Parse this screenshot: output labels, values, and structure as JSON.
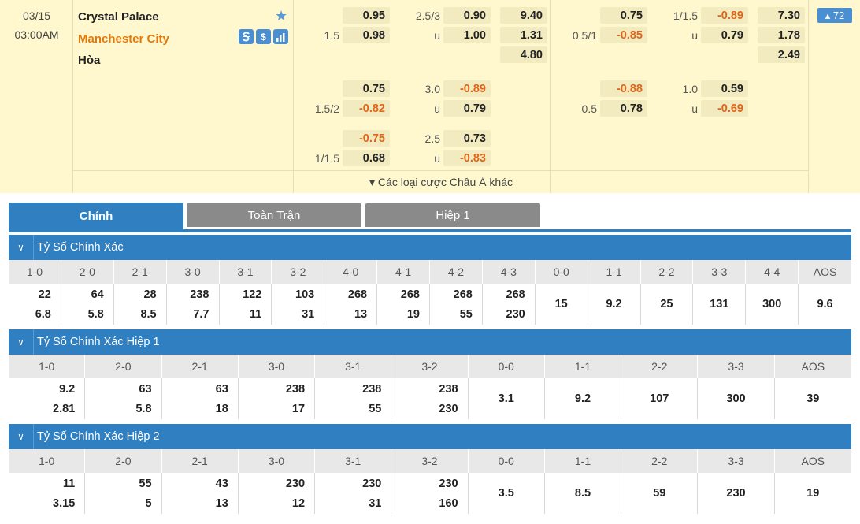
{
  "match": {
    "date": "03/15",
    "time": "03:00AM",
    "home": "Crystal Palace",
    "away": "Manchester City",
    "draw": "Hòa",
    "tools": [
      "S",
      "$",
      "chart"
    ],
    "full_time": {
      "rows": [
        {
          "hdp": "",
          "h": "0.95",
          "ou": "2.5/3",
          "o": "0.90",
          "x1": "9.40"
        },
        {
          "hdp": "1.5",
          "h": "0.98",
          "ou": "u",
          "o": "1.00",
          "x1": "1.31"
        },
        {
          "hdp": "",
          "h": "",
          "ou": "",
          "o": "",
          "x1": "4.80"
        },
        {
          "hdp": "",
          "h": "0.75",
          "ou": "3.0",
          "o": "-0.89",
          "x1": ""
        },
        {
          "hdp": "1.5/2",
          "h": "-0.82",
          "ou": "u",
          "o": "0.79",
          "x1": ""
        },
        {
          "hdp": "",
          "h": "-0.75",
          "ou": "2.5",
          "o": "0.73",
          "x1": ""
        },
        {
          "hdp": "1/1.5",
          "h": "0.68",
          "ou": "u",
          "o": "-0.83",
          "x1": ""
        }
      ]
    },
    "half_time": {
      "rows": [
        {
          "hdp": "",
          "h": "0.75",
          "ou": "1/1.5",
          "o": "-0.89",
          "x1": "7.30"
        },
        {
          "hdp": "0.5/1",
          "h": "-0.85",
          "ou": "u",
          "o": "0.79",
          "x1": "1.78"
        },
        {
          "hdp": "",
          "h": "",
          "ou": "",
          "o": "",
          "x1": "2.49"
        },
        {
          "hdp": "",
          "h": "-0.88",
          "ou": "1.0",
          "o": "0.59",
          "x1": ""
        },
        {
          "hdp": "0.5",
          "h": "0.78",
          "ou": "u",
          "o": "-0.69",
          "x1": ""
        }
      ]
    },
    "more_label": "▾ Các loại cược Châu Á khác",
    "more_count": "▴ 72"
  },
  "tabs": [
    {
      "label": "Chính",
      "active": true
    },
    {
      "label": "Toàn Trận",
      "active": false
    },
    {
      "label": "Hiệp 1",
      "active": false
    }
  ],
  "sections": [
    {
      "title": "Tỷ Số Chính Xác",
      "scores": [
        "1-0",
        "2-0",
        "2-1",
        "3-0",
        "3-1",
        "3-2",
        "4-0",
        "4-1",
        "4-2",
        "4-3",
        "0-0",
        "1-1",
        "2-2",
        "3-3",
        "4-4",
        "AOS"
      ],
      "values": [
        [
          "22",
          "6.8"
        ],
        [
          "64",
          "5.8"
        ],
        [
          "28",
          "8.5"
        ],
        [
          "238",
          "7.7"
        ],
        [
          "122",
          "11"
        ],
        [
          "103",
          "31"
        ],
        [
          "268",
          "13"
        ],
        [
          "268",
          "19"
        ],
        [
          "268",
          "55"
        ],
        [
          "268",
          "230"
        ],
        [
          "15"
        ],
        [
          "9.2"
        ],
        [
          "25"
        ],
        [
          "131"
        ],
        [
          "300"
        ],
        [
          "9.6"
        ]
      ]
    },
    {
      "title": "Tỷ Số Chính Xác Hiệp 1",
      "scores": [
        "1-0",
        "2-0",
        "2-1",
        "3-0",
        "3-1",
        "3-2",
        "0-0",
        "1-1",
        "2-2",
        "3-3",
        "AOS"
      ],
      "values": [
        [
          "9.2",
          "2.81"
        ],
        [
          "63",
          "5.8"
        ],
        [
          "63",
          "18"
        ],
        [
          "238",
          "17"
        ],
        [
          "238",
          "55"
        ],
        [
          "238",
          "230"
        ],
        [
          "3.1"
        ],
        [
          "9.2"
        ],
        [
          "107"
        ],
        [
          "300"
        ],
        [
          "39"
        ]
      ]
    },
    {
      "title": "Tỷ Số Chính Xác Hiệp 2",
      "scores": [
        "1-0",
        "2-0",
        "2-1",
        "3-0",
        "3-1",
        "3-2",
        "0-0",
        "1-1",
        "2-2",
        "3-3",
        "AOS"
      ],
      "values": [
        [
          "11",
          "3.15"
        ],
        [
          "55",
          "5"
        ],
        [
          "43",
          "13"
        ],
        [
          "230",
          "12"
        ],
        [
          "230",
          "31"
        ],
        [
          "230",
          "160"
        ],
        [
          "3.5"
        ],
        [
          "8.5"
        ],
        [
          "59"
        ],
        [
          "230"
        ],
        [
          "19"
        ]
      ]
    }
  ],
  "colors": {
    "accent": "#2f7fc1",
    "negative": "#e0651a",
    "row_bg": "#fff8cf",
    "away": "#e07b10"
  }
}
